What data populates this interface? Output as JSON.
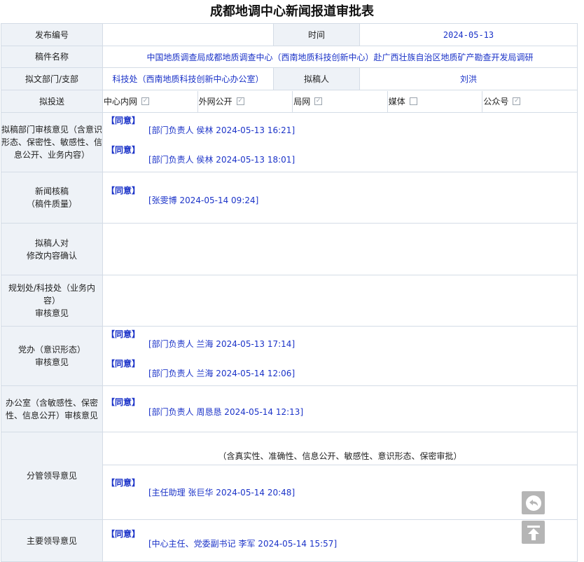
{
  "page_title": "成都地调中心新闻报道审批表",
  "row_publish": {
    "label": "发布编号",
    "value": "",
    "time_label": "时间",
    "time_value": "2024-05-13"
  },
  "row_manuscript": {
    "label": "稿件名称",
    "value": "中国地质调查局成都地质调查中心（西南地质科技创新中心）赴广西壮族自治区地质矿产勘查开发局调研"
  },
  "row_department": {
    "label": "拟文部门/支部",
    "value": "科技处（西南地质科技创新中心办公室）",
    "drafter_label": "拟稿人",
    "drafter_value": "刘洪"
  },
  "row_channels": {
    "label": "拟投送",
    "channels": [
      {
        "name": "中心内网",
        "checked": true
      },
      {
        "name": "外网公开",
        "checked": true
      },
      {
        "name": "局网",
        "checked": true
      },
      {
        "name": "媒体",
        "checked": false
      },
      {
        "name": "公众号",
        "checked": true
      }
    ]
  },
  "rows": [
    {
      "label": "拟稿部门审核意见（含意识形态、保密性、敏感性、信息公开、业务内容）",
      "height": 76,
      "entries": [
        {
          "agree": "【同意】",
          "sig": "[部门负责人 侯林 2024-05-13 16:21]"
        },
        {
          "agree": "【同意】",
          "sig": "[部门负责人 侯林 2024-05-13 18:01]"
        }
      ]
    },
    {
      "label": "新闻核稿\n（稿件质量）",
      "height": 73,
      "entries": [
        {
          "agree": "【同意】",
          "sig": "[张雯博 2024-05-14 09:24]"
        }
      ]
    },
    {
      "label": "拟稿人对\n修改内容确认",
      "height": 74,
      "entries": []
    },
    {
      "label": "规划处/科技处（业务内容）\n审核意见",
      "height": 73,
      "entries": []
    },
    {
      "label": "党办（意识形态）\n审核意见",
      "height": 77,
      "entries": [
        {
          "agree": "【同意】",
          "sig": "[部门负责人 兰海 2024-05-13 17:14]"
        },
        {
          "agree": "【同意】",
          "sig": "[部门负责人 兰海 2024-05-14 12:06]"
        }
      ]
    },
    {
      "label": "办公室（含敏感性、保密性、信息公开）审核意见",
      "height": 66,
      "entries": [
        {
          "agree": "【同意】",
          "sig": "[部门负责人 周恳恳 2024-05-14 12:13]"
        }
      ]
    },
    {
      "label": "分管领导意见",
      "height": 125,
      "note": "（含真实性、准确性、信息公开、敏感性、意识形态、保密审批）",
      "entries": [
        {
          "agree": "【同意】",
          "sig": "[主任助理 张巨华 2024-05-14 20:48]"
        }
      ]
    },
    {
      "label": "主要领导意见",
      "height": 60,
      "entries": [
        {
          "agree": "【同意】",
          "sig": "[中心主任、党委副书记 李军 2024-05-14 15:57]"
        }
      ]
    }
  ],
  "icons": {
    "back": "back-arrow-icon",
    "top": "scroll-to-top-icon"
  },
  "colors": {
    "label_bg": "#eef2f7",
    "value_text": "#1b33c8",
    "border": "#d4dce6",
    "float_btn": "#b5b5b5"
  }
}
